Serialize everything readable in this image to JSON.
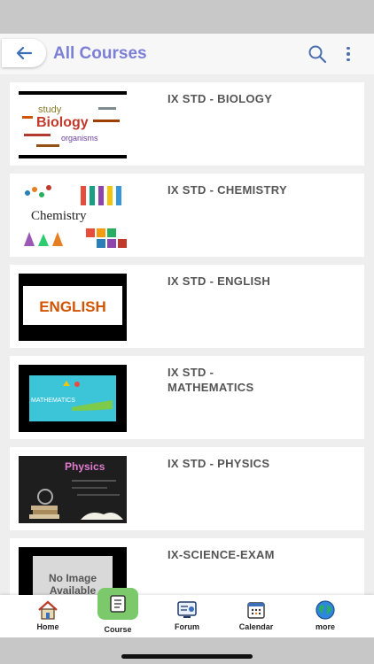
{
  "header": {
    "title": "All Courses",
    "back_icon": "arrow-left-icon",
    "search_icon": "search-icon",
    "menu_icon": "more-vertical-icon",
    "accent": "#7b7fd6"
  },
  "courses": [
    {
      "title": "IX STD - BIOLOGY",
      "thumb_words": [
        "study",
        "Biology",
        "organisms"
      ]
    },
    {
      "title": "IX STD - CHEMISTRY",
      "thumb_words": [
        "Chemistry"
      ]
    },
    {
      "title": "IX STD - ENGLISH",
      "thumb_words": [
        "ENGLISH"
      ]
    },
    {
      "title": "IX STD - MATHEMATICS",
      "thumb_words": [
        "MATHEMATICS"
      ]
    },
    {
      "title": "IX STD - PHYSICS",
      "thumb_words": [
        "Physics"
      ]
    },
    {
      "title": "IX-SCIENCE-EXAM",
      "thumb_words": [
        "No Image",
        "Available"
      ]
    }
  ],
  "bottom_nav": {
    "active": "Course",
    "active_color": "#7cc96b",
    "items": [
      {
        "label": "Home",
        "icon": "home-icon"
      },
      {
        "label": "Course",
        "icon": "book-icon"
      },
      {
        "label": "Forum",
        "icon": "forum-icon"
      },
      {
        "label": "Calendar",
        "icon": "calendar-icon"
      },
      {
        "label": "more",
        "icon": "globe-icon"
      }
    ]
  }
}
